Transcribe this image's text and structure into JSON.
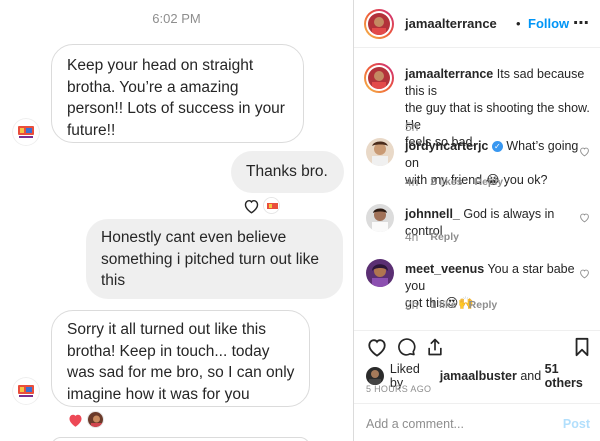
{
  "conversation": {
    "timestamp": "6:02 PM",
    "messages": [
      {
        "lines": [
          "Keep your head on straight",
          "brotha. You’re a amazing",
          "person!! Lots of success in your",
          "future!!"
        ]
      },
      {
        "lines": [
          "Thanks bro."
        ]
      },
      {
        "lines": [
          "Honestly cant even believe",
          "something i pitched turn out like",
          "this"
        ]
      },
      {
        "lines": [
          "Sorry it all turned out like this",
          "brotha! Keep in touch... today",
          "was sad for me bro, so I can only",
          "imagine how it was for you"
        ]
      }
    ],
    "reactions": [
      {
        "emoji": "heart-outline-icon",
        "color": "#262626"
      },
      {
        "emoji": "heart-filled-icon",
        "color": "#ed4956"
      }
    ]
  },
  "post": {
    "header": {
      "username": "jamaalterrance",
      "separator": "•",
      "follow": "Follow",
      "more": "•••"
    },
    "caption": {
      "username": "jamaalterrance",
      "text": "Its sad because this is the guy that is shooting the show. He feels so bad.",
      "line1": "Its sad because this is",
      "line2": "the guy that is shooting the show. He",
      "line3": "feels so bad.",
      "time": "5h"
    },
    "comments": [
      {
        "username": "jordyncarterjc",
        "line1": "What’s going on",
        "line2": "with my friend 😭 you ok?",
        "time": "4h",
        "likes": "2 likes",
        "reply": "Reply",
        "verified": true
      },
      {
        "username": "johnnell_",
        "line1": "God is always in control",
        "line2": "",
        "time": "4h",
        "likes": "",
        "reply": "Reply",
        "verified": false
      },
      {
        "username": "meet_veenus",
        "line1": "You a star babe you",
        "line2": "got this😍🙌",
        "time": "2h",
        "likes": "1 like",
        "reply": "Reply",
        "verified": false
      }
    ],
    "liked_by": {
      "prefix": "Liked by",
      "user": "jamaalbuster",
      "and": "and",
      "others": "51 others"
    },
    "posted_ago": "5 HOURS AGO",
    "add_comment_placeholder": "Add a comment...",
    "post_button": "Post"
  },
  "colors": {
    "accent": "#0095f6",
    "like_red": "#ed4956",
    "muted": "#8e8e8e",
    "post_disabled": "#b2dffc"
  }
}
